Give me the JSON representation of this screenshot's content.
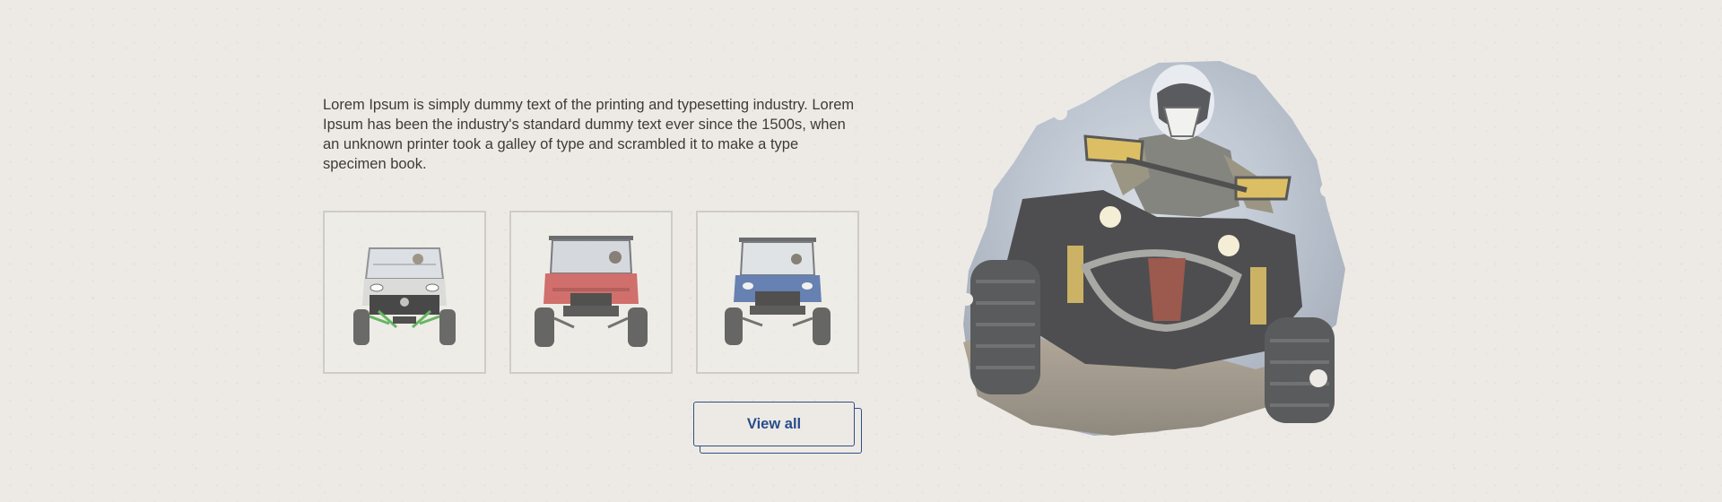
{
  "intro": {
    "text": "Lorem Ipsum is simply dummy text of the printing and typesetting industry. Lorem Ipsum has been the industry's standard dummy text ever since the 1500s, when an unknown printer took a galley of type and scrambled it to make a type specimen book."
  },
  "vehicles": [
    {
      "icon": "utv-white-icon",
      "body_color": "#d7d8d6",
      "accent_color": "#46a843"
    },
    {
      "icon": "utv-red-icon",
      "body_color": "#c9504d",
      "accent_color": "#3a3a3a"
    },
    {
      "icon": "utv-blue-icon",
      "body_color": "#4567a6",
      "accent_color": "#3a3a3a"
    }
  ],
  "view_all": {
    "label": "View all"
  },
  "colors": {
    "background": "#edeae5",
    "text": "#3e3a36",
    "accent": "#2f4f86",
    "card_border": "#cfcbc5"
  },
  "hero": {
    "icon": "atv-rider-photo"
  }
}
